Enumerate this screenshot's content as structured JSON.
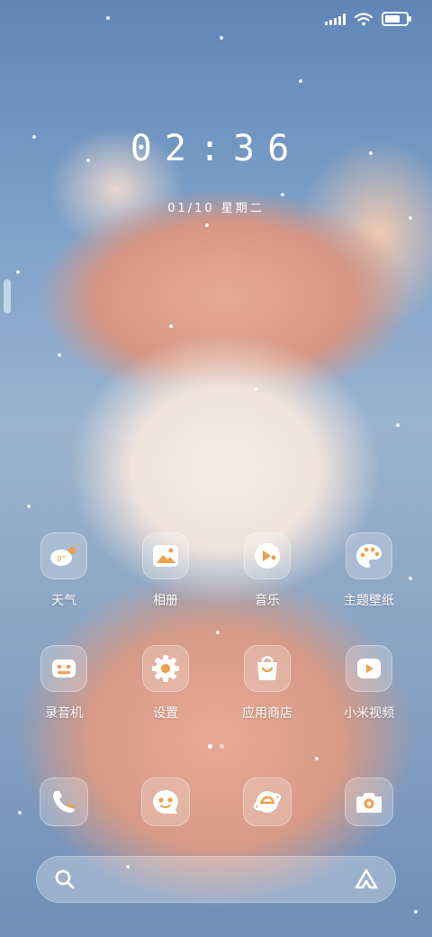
{
  "status_bar": {
    "signal_icon": "signal-icon",
    "wifi_icon": "wifi-icon",
    "battery_icon": "battery-icon",
    "battery_level": 0.9
  },
  "lock": {
    "time": "02:36",
    "date": "01/10 星期二"
  },
  "apps_row1": [
    {
      "label": "天气",
      "icon": "weather-icon",
      "badge": "0°"
    },
    {
      "label": "相册",
      "icon": "gallery-icon"
    },
    {
      "label": "音乐",
      "icon": "music-icon"
    },
    {
      "label": "主题壁纸",
      "icon": "palette-icon"
    }
  ],
  "apps_row2": [
    {
      "label": "录音机",
      "icon": "recorder-icon"
    },
    {
      "label": "设置",
      "icon": "settings-gear-icon"
    },
    {
      "label": "应用商店",
      "icon": "app-store-icon"
    },
    {
      "label": "小米视频",
      "icon": "video-play-icon"
    }
  ],
  "dock": [
    {
      "icon": "phone-icon"
    },
    {
      "icon": "messages-icon"
    },
    {
      "icon": "browser-icon"
    },
    {
      "icon": "camera-icon"
    }
  ],
  "page_indicator": {
    "pages": 2,
    "current": 1
  },
  "search": {
    "search_icon": "search-icon",
    "assistant_icon": "assistant-icon"
  },
  "colors": {
    "icon_accent": "#f0a04b",
    "text": "#ffffff"
  }
}
